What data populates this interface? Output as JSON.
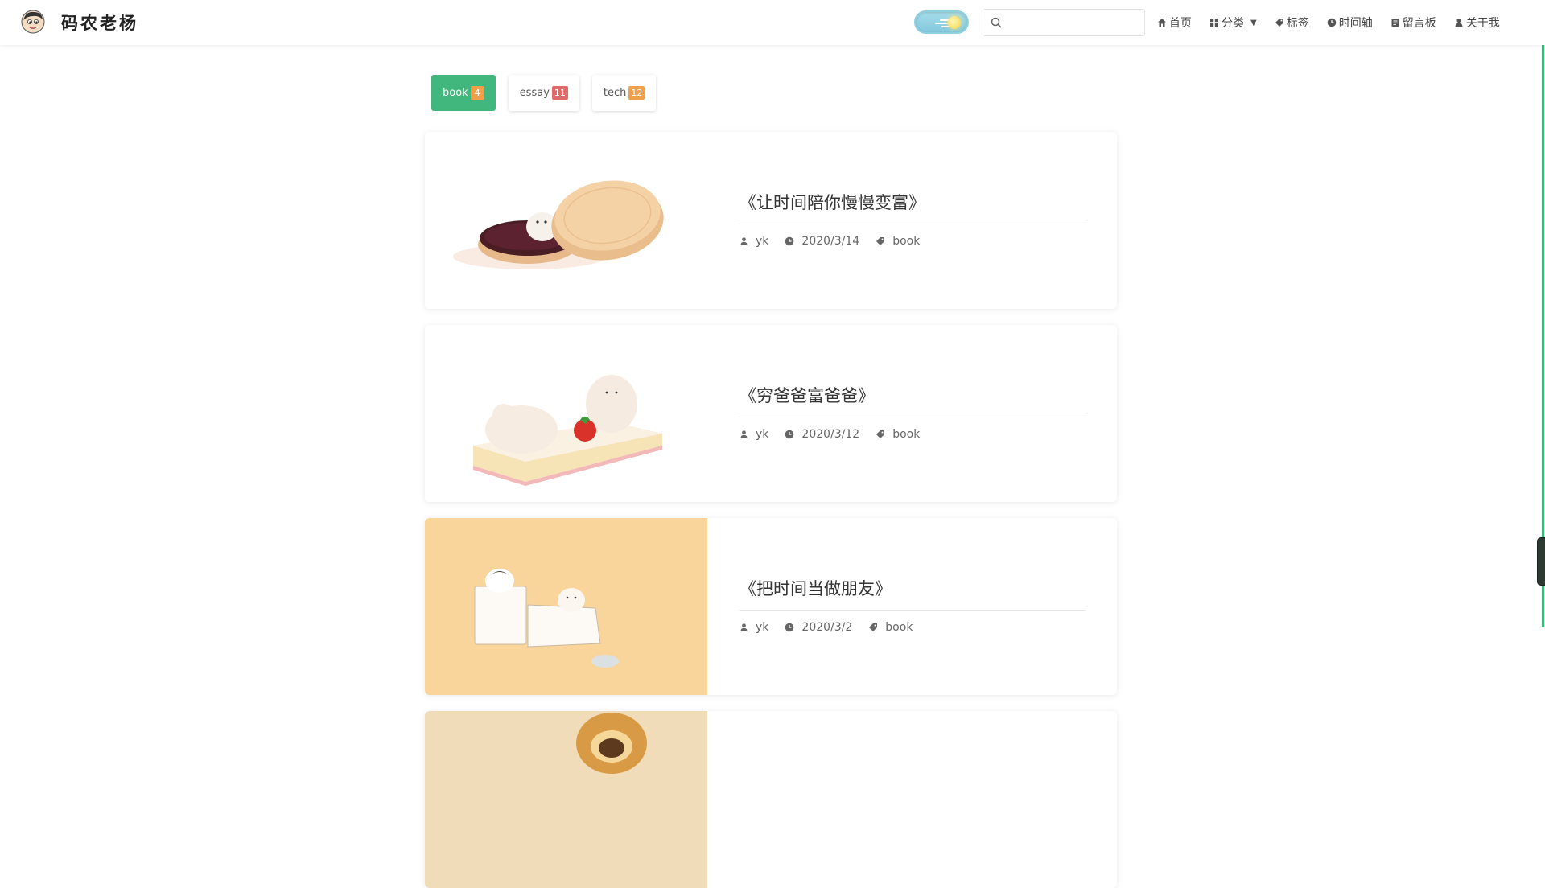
{
  "header": {
    "site_title": "码农老杨",
    "search": {
      "placeholder": "",
      "value": ""
    },
    "theme": "light",
    "nav": [
      {
        "label": "首页",
        "icon": "home-icon"
      },
      {
        "label": "分类",
        "icon": "grid-icon",
        "has_dropdown": true
      },
      {
        "label": "标签",
        "icon": "tag-icon"
      },
      {
        "label": "时间轴",
        "icon": "clock-icon"
      },
      {
        "label": "留言板",
        "icon": "message-board-icon"
      },
      {
        "label": "关于我",
        "icon": "user-icon"
      }
    ]
  },
  "categories": [
    {
      "label": "book",
      "count": "4",
      "active": true,
      "badge_color": "#f0a04b"
    },
    {
      "label": "essay",
      "count": "11",
      "active": false,
      "badge_color": "#e06a6a"
    },
    {
      "label": "tech",
      "count": "12",
      "active": false,
      "badge_color": "#f0a04b"
    }
  ],
  "posts": [
    {
      "title": "《让时间陪你慢慢变富》",
      "author": "yk",
      "date": "2020/3/14",
      "tag": "book"
    },
    {
      "title": "《穷爸爸富爸爸》",
      "author": "yk",
      "date": "2020/3/12",
      "tag": "book"
    },
    {
      "title": "《把时间当做朋友》",
      "author": "yk",
      "date": "2020/3/2",
      "tag": "book"
    },
    {
      "title": "",
      "author": "",
      "date": "",
      "tag": ""
    }
  ],
  "colors": {
    "accent_green": "#41b77e",
    "badge_orange": "#f0a04b",
    "badge_red": "#e06a6a"
  }
}
